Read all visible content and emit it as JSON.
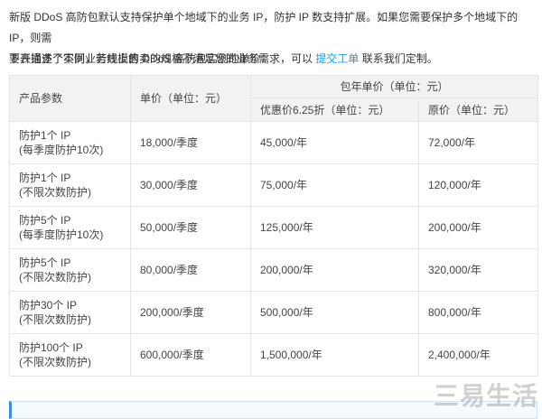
{
  "intro": {
    "line1": "新版 DDoS 高防包默认支持保护单个地域下的业务 IP，防护 IP 数支持扩展。如果您需要保护多个地域下的 IP，则需",
    "line2_before": "要开通多个实例，若线上售卖的规格不满足您的业务需求，可以 ",
    "link": "提交工单",
    "line2_after": " 联系我们定制。"
  },
  "subtitle": "下表描述了不同业务规模的 DDoS 高防包实例的单价：",
  "table": {
    "headers": {
      "param": "产品参数",
      "unit_price": "单价（单位：元）",
      "annual_group": "包年单价（单位：元）",
      "discount": "优惠价6.25折（单位：元）",
      "original": "原价（单位：元）"
    },
    "rows": [
      {
        "param_line1": "防护1个 IP",
        "param_line2": "(每季度防护10次)",
        "unit": "18,000/季度",
        "discount": "45,000/年",
        "original": "72,000/年"
      },
      {
        "param_line1": "防护1个 IP",
        "param_line2": "(不限次数防护)",
        "unit": "30,000/季度",
        "discount": "75,000/年",
        "original": "120,000/年"
      },
      {
        "param_line1": "防护5个 IP",
        "param_line2": "(每季度防护10次)",
        "unit": "50,000/季度",
        "discount": "125,000/年",
        "original": "200,000/年"
      },
      {
        "param_line1": "防护5个 IP",
        "param_line2": "(不限次数防护)",
        "unit": "80,000/季度",
        "discount": "200,000/年",
        "original": "320,000/年"
      },
      {
        "param_line1": "防护30个 IP",
        "param_line2": "(不限次数防护)",
        "unit": "200,000/季度",
        "discount": "500,000/年",
        "original": "800,000/年"
      },
      {
        "param_line1": "防护100个 IP",
        "param_line2": "(不限次数防护)",
        "unit": "600,000/季度",
        "discount": "1,500,000/年",
        "original": "2,400,000/年"
      }
    ]
  },
  "watermark": "三易生活"
}
